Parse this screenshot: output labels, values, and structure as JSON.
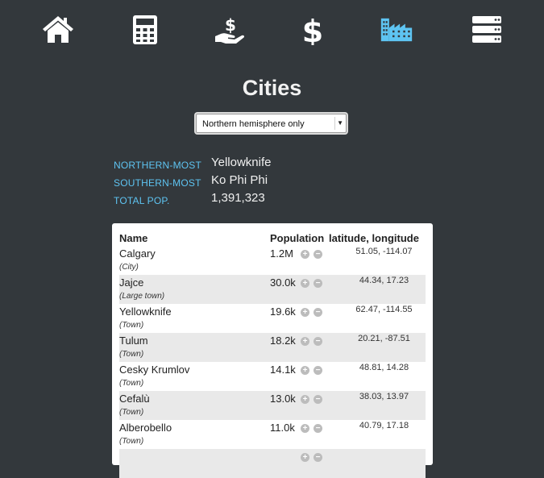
{
  "nav": {
    "items": [
      {
        "icon": "home-icon"
      },
      {
        "icon": "calculator-icon"
      },
      {
        "icon": "hand-dollar-icon"
      },
      {
        "icon": "dollar-icon"
      },
      {
        "icon": "city-icon",
        "active": true
      },
      {
        "icon": "server-icon"
      }
    ],
    "color": "#ffffff",
    "active_color": "#5ec4f2"
  },
  "page": {
    "title": "Cities"
  },
  "filter": {
    "selected": "Northern hemisphere only"
  },
  "stats": [
    {
      "label": "NORTHERN-MOST",
      "value": "Yellowknife"
    },
    {
      "label": "SOUTHERN-MOST",
      "value": "Ko Phi Phi"
    },
    {
      "label": "TOTAL POP.",
      "value": "1,391,323"
    }
  ],
  "table": {
    "headers": {
      "name": "Name",
      "population": "Population",
      "coords": "latitude, longitude"
    },
    "rows": [
      {
        "name": "Calgary",
        "type": "(City)",
        "pop": "1.2M",
        "coords": "51.05, -114.07"
      },
      {
        "name": "Jajce",
        "type": "(Large town)",
        "pop": "30.0k",
        "coords": "44.34, 17.23"
      },
      {
        "name": "Yellowknife",
        "type": "(Town)",
        "pop": "19.6k",
        "coords": "62.47, -114.55"
      },
      {
        "name": "Tulum",
        "type": "(Town)",
        "pop": "18.2k",
        "coords": "20.21, -87.51"
      },
      {
        "name": "Cesky Krumlov",
        "type": "(Town)",
        "pop": "14.1k",
        "coords": "48.81, 14.28"
      },
      {
        "name": "Cefalù",
        "type": "(Town)",
        "pop": "13.0k",
        "coords": "38.03, 13.97"
      },
      {
        "name": "Alberobello",
        "type": "(Town)",
        "pop": "11.0k",
        "coords": "40.79, 17.18"
      },
      {
        "name": "",
        "type": "",
        "pop": "",
        "coords": ""
      }
    ]
  }
}
